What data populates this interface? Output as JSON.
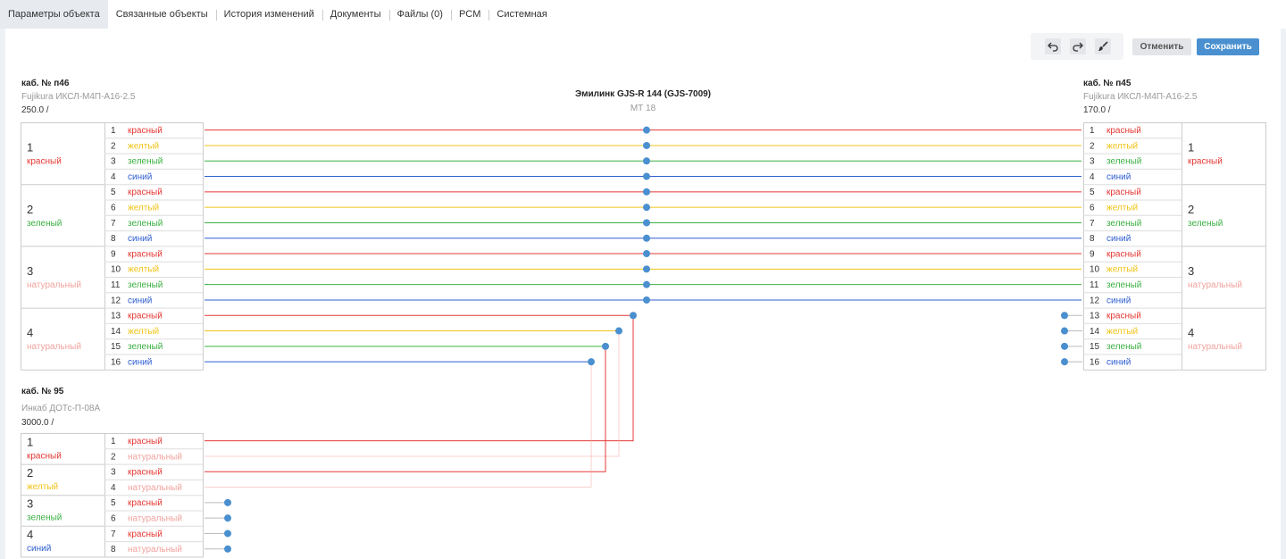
{
  "tabs": [
    {
      "label": "Параметры объекта",
      "active": true
    },
    {
      "label": "Связанные объекты"
    },
    {
      "label": "История изменений"
    },
    {
      "label": "Документы"
    },
    {
      "label": "Файлы (0)"
    },
    {
      "label": "PCM"
    },
    {
      "label": "Системная"
    }
  ],
  "toolbar": {
    "cancel_label": "Отменить",
    "save_label": "Сохранить",
    "undo_icon": "undo-icon",
    "redo_icon": "redo-icon",
    "brush_icon": "brush-icon"
  },
  "colors": {
    "красный": "#e53935",
    "желтый": "#f0c419",
    "зеленый": "#3cb043",
    "синий": "#2f5fd0",
    "натуральный": "#f0a39e",
    "dot": "#4a8fcf",
    "accent": "#4a90d0"
  },
  "splice": {
    "name": "Эмилинк GJS-R 144 (GJS-7009)",
    "sub": "МТ 18"
  },
  "cable_left": {
    "name": "каб. № п46",
    "type": "Fujikura ИКСЛ-М4П-А16-2.5",
    "length": "250.0 /",
    "modules": [
      {
        "num": "1",
        "color": "красный"
      },
      {
        "num": "2",
        "color": "зеленый"
      },
      {
        "num": "3",
        "color": "натуральный"
      },
      {
        "num": "4",
        "color": "натуральный"
      }
    ],
    "fibers": [
      {
        "n": "1",
        "c": "красный"
      },
      {
        "n": "2",
        "c": "желтый"
      },
      {
        "n": "3",
        "c": "зеленый"
      },
      {
        "n": "4",
        "c": "синий"
      },
      {
        "n": "5",
        "c": "красный"
      },
      {
        "n": "6",
        "c": "желтый"
      },
      {
        "n": "7",
        "c": "зеленый"
      },
      {
        "n": "8",
        "c": "синий"
      },
      {
        "n": "9",
        "c": "красный"
      },
      {
        "n": "10",
        "c": "желтый"
      },
      {
        "n": "11",
        "c": "зеленый"
      },
      {
        "n": "12",
        "c": "синий"
      },
      {
        "n": "13",
        "c": "красный"
      },
      {
        "n": "14",
        "c": "желтый"
      },
      {
        "n": "15",
        "c": "зеленый"
      },
      {
        "n": "16",
        "c": "синий"
      }
    ]
  },
  "cable_right": {
    "name": "каб. № п45",
    "type": "Fujikura ИКСЛ-М4П-А16-2.5",
    "length": "170.0 /",
    "modules": [
      {
        "num": "1",
        "color": "красный"
      },
      {
        "num": "2",
        "color": "зеленый"
      },
      {
        "num": "3",
        "color": "натуральный"
      },
      {
        "num": "4",
        "color": "натуральный"
      }
    ],
    "fibers": [
      {
        "n": "1",
        "c": "красный"
      },
      {
        "n": "2",
        "c": "желтый"
      },
      {
        "n": "3",
        "c": "зеленый"
      },
      {
        "n": "4",
        "c": "синий"
      },
      {
        "n": "5",
        "c": "красный"
      },
      {
        "n": "6",
        "c": "желтый"
      },
      {
        "n": "7",
        "c": "зеленый"
      },
      {
        "n": "8",
        "c": "синий"
      },
      {
        "n": "9",
        "c": "красный"
      },
      {
        "n": "10",
        "c": "желтый"
      },
      {
        "n": "11",
        "c": "зеленый"
      },
      {
        "n": "12",
        "c": "синий"
      },
      {
        "n": "13",
        "c": "красный"
      },
      {
        "n": "14",
        "c": "желтый"
      },
      {
        "n": "15",
        "c": "зеленый"
      },
      {
        "n": "16",
        "c": "синий"
      }
    ]
  },
  "cable_bottom": {
    "name": "каб. № 95",
    "type": "Инкаб ДОТс-П-08А",
    "length": "3000.0 /",
    "modules": [
      {
        "num": "1",
        "color": "красный"
      },
      {
        "num": "2",
        "color": "желтый"
      },
      {
        "num": "3",
        "color": "зеленый"
      },
      {
        "num": "4",
        "color": "синий"
      }
    ],
    "fibers": [
      {
        "n": "1",
        "c": "красный"
      },
      {
        "n": "2",
        "c": "натуральный"
      },
      {
        "n": "3",
        "c": "красный"
      },
      {
        "n": "4",
        "c": "натуральный"
      },
      {
        "n": "5",
        "c": "красный"
      },
      {
        "n": "6",
        "c": "натуральный"
      },
      {
        "n": "7",
        "c": "красный"
      },
      {
        "n": "8",
        "c": "натуральный"
      }
    ]
  }
}
